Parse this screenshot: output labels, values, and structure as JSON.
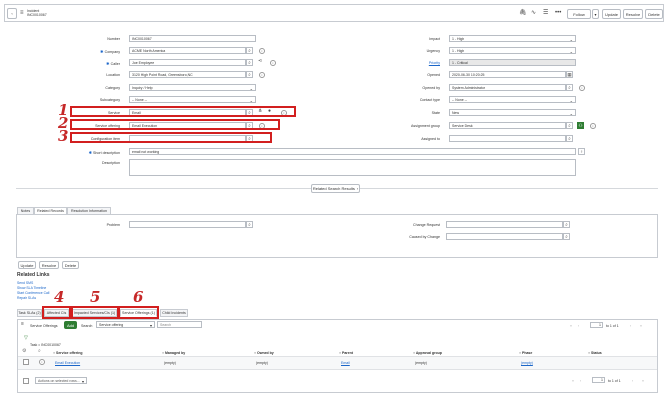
{
  "header": {
    "record_type": "Incident",
    "record_number": "INC0010067",
    "buttons": {
      "follow": "Follow",
      "update": "Update",
      "resolve": "Resolve",
      "delete": "Delete"
    }
  },
  "form": {
    "left": {
      "number": {
        "label": "Number",
        "value": "INC0010067"
      },
      "company": {
        "label": "Company",
        "value": "ACME North America"
      },
      "caller": {
        "label": "Caller",
        "value": "Joe Employee"
      },
      "location": {
        "label": "Location",
        "value": "3120 High Point Road, Greensboro,NC"
      },
      "category": {
        "label": "Category",
        "value": "Inquiry / Help"
      },
      "subcategory": {
        "label": "Subcategory",
        "value": "-- None --"
      },
      "service": {
        "label": "Service",
        "value": "Email"
      },
      "service_offering": {
        "label": "Service offering",
        "value": "Email Execution"
      },
      "configuration_item": {
        "label": "Configuration item",
        "value": ""
      },
      "short_description": {
        "label": "Short description",
        "value": "email not working"
      },
      "description": {
        "label": "Description",
        "value": ""
      }
    },
    "right": {
      "impact": {
        "label": "Impact",
        "value": "1 - High"
      },
      "urgency": {
        "label": "Urgency",
        "value": "1 - High"
      },
      "priority": {
        "label": "Priority",
        "value": "1 - Critical"
      },
      "opened": {
        "label": "Opened",
        "value": "2020-06-30 10:20:25"
      },
      "opened_by": {
        "label": "Opened by",
        "value": "System Administrator"
      },
      "contact_type": {
        "label": "Contact type",
        "value": "-- None --"
      },
      "state": {
        "label": "State",
        "value": "New"
      },
      "assignment_group": {
        "label": "Assignment group",
        "value": "Service Desk"
      },
      "assigned_to": {
        "label": "Assigned to",
        "value": ""
      }
    },
    "related_search_button": "Related Search Results"
  },
  "section_tabs": [
    "Notes",
    "Related Records",
    "Resolution Information"
  ],
  "related_records": {
    "problem_label": "Problem",
    "change_request_label": "Change Request",
    "caused_by_change_label": "Caused by Change"
  },
  "bottom_buttons": [
    "Update",
    "Resolve",
    "Delete"
  ],
  "related_links": {
    "title": "Related Links",
    "items": [
      "Send SMS",
      "Show SLA Timeline",
      "Start Conference Call",
      "Repair SLAs"
    ]
  },
  "related_list_tabs": [
    "Task SLAs (2)",
    "Affected CIs",
    "Impacted Services/CIs (1)",
    "Service Offerings (1)",
    "Child Incidents"
  ],
  "list": {
    "title": "Service Offerings",
    "new_button": "Add",
    "search_label": "Search",
    "search_field": "Service offering",
    "search_placeholder": "Search",
    "pager": {
      "page": "1",
      "range": "to 1 of 1"
    },
    "breadcrumb": "Task = INC0010067",
    "columns": [
      "Service offering",
      "Managed by",
      "Owned by",
      "Parent",
      "Approval group",
      "Phase",
      "Status"
    ],
    "rows": [
      {
        "service_offering": "Email Execution",
        "managed_by": "(empty)",
        "owned_by": "(empty)",
        "parent": "Email",
        "approval_group": "(empty)",
        "phase": "(empty)",
        "status": ""
      }
    ],
    "actions_placeholder": "Actions on selected rows..."
  },
  "annotations": [
    "1",
    "2",
    "3",
    "4",
    "5",
    "6"
  ],
  "colors": {
    "annotation": "#d21f1f",
    "link": "#1b66c9",
    "new_button": "#2e7d32",
    "filter": "#2e7d32"
  }
}
